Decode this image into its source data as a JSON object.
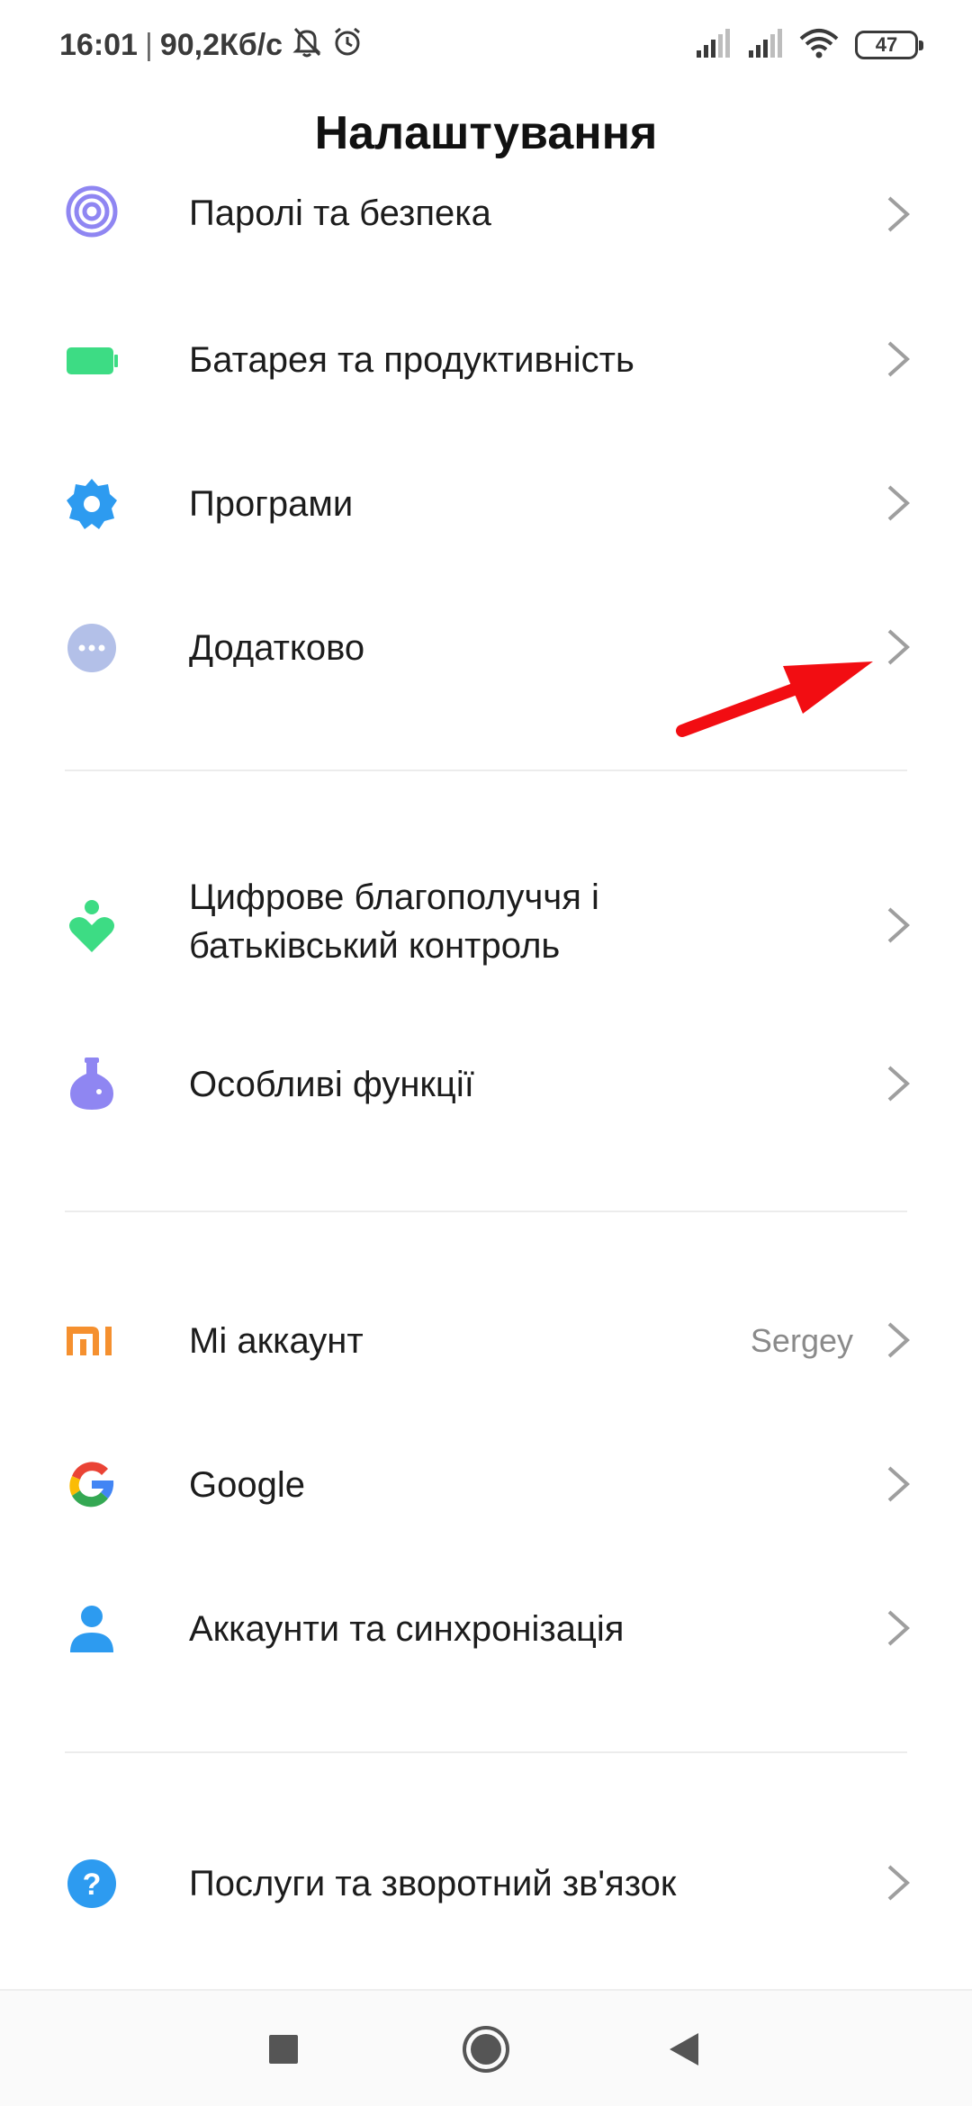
{
  "status_bar": {
    "time": "16:01",
    "separator": "|",
    "net_speed": "90,2Кб/с",
    "battery": "47"
  },
  "header": {
    "title": "Налаштування"
  },
  "settings": {
    "passwords": {
      "label": "Паролі та безпека"
    },
    "battery": {
      "label": "Батарея та продуктивність"
    },
    "apps": {
      "label": "Програми"
    },
    "additional": {
      "label": "Додатково"
    },
    "wellbeing": {
      "label_line1": "Цифрове благополуччя і",
      "label_line2": "батьківський контроль"
    },
    "special": {
      "label": "Особливі функції"
    },
    "mi_account": {
      "label": "Mi аккаунт",
      "value": "Sergey"
    },
    "google": {
      "label": "Google"
    },
    "accounts_sync": {
      "label": "Аккаунти та синхронізація"
    },
    "services": {
      "label": "Послуги та зворотний зв'язок"
    }
  },
  "colors": {
    "accent_blue": "#2d9bf0",
    "battery_green": "#3ddc84",
    "lavender": "#8f86f2",
    "additional_gray": "#b3c0e8",
    "mi_orange": "#f5902f",
    "arrow_red": "#f20d12"
  }
}
